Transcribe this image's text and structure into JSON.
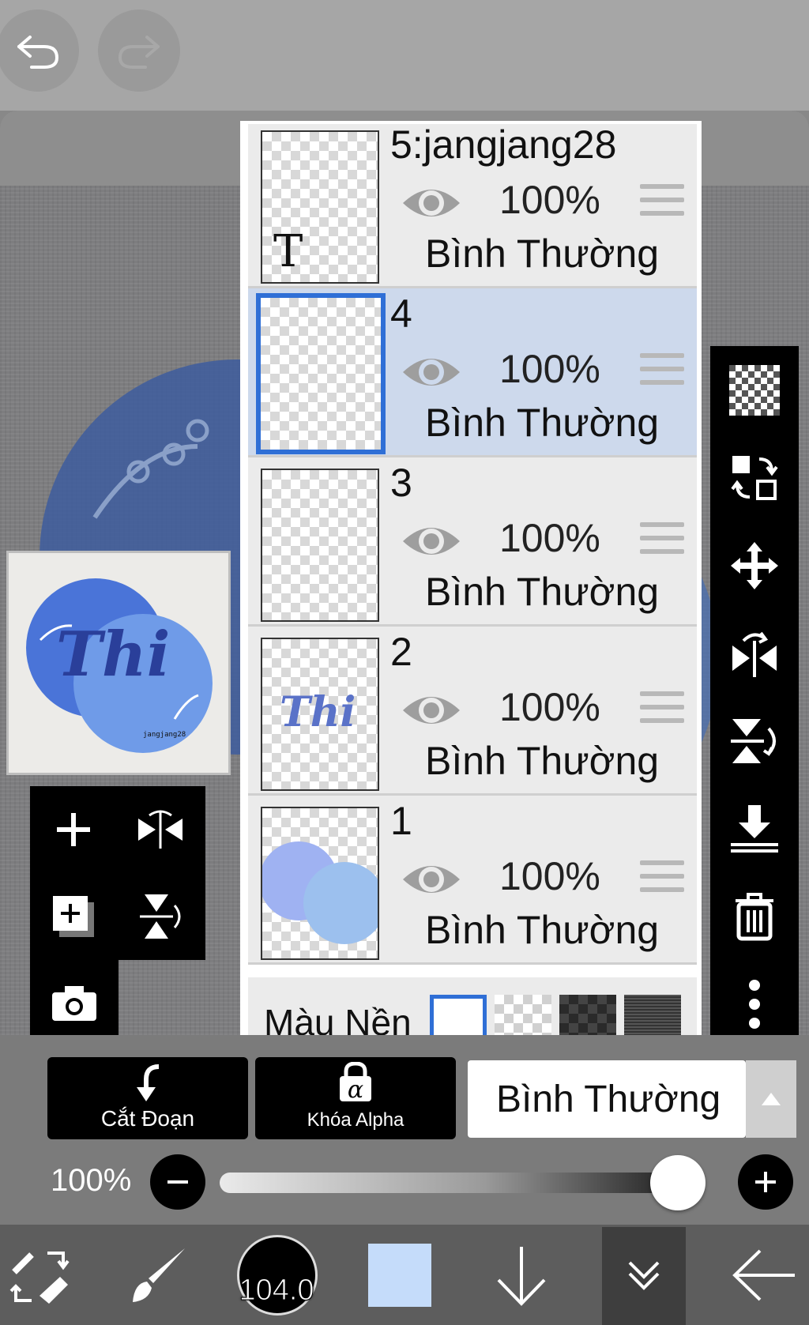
{
  "topbar": {
    "undo_icon": "undo-icon",
    "redo_icon": "redo-icon"
  },
  "layers": [
    {
      "name": "5:jangjang28",
      "opacity": "100%",
      "blend": "Bình Thường",
      "selected": false,
      "thumb": "text-T"
    },
    {
      "name": "4",
      "opacity": "100%",
      "blend": "Bình Thường",
      "selected": true,
      "thumb": "empty"
    },
    {
      "name": "3",
      "opacity": "100%",
      "blend": "Bình Thường",
      "selected": false,
      "thumb": "empty"
    },
    {
      "name": "2",
      "opacity": "100%",
      "blend": "Bình Thường",
      "selected": false,
      "thumb": "text-thi"
    },
    {
      "name": "1",
      "opacity": "100%",
      "blend": "Bình Thường",
      "selected": false,
      "thumb": "circles"
    }
  ],
  "thumb_text": {
    "layer5_T": "T",
    "layer2_thi": "Thi"
  },
  "preview": {
    "text": "Thi",
    "small_text": "jangjang28"
  },
  "background_row": {
    "label": "Màu Nền"
  },
  "controls": {
    "clip_label": "Cắt Đoạn",
    "alpha_lock_label": "Khóa Alpha",
    "alpha_symbol": "α",
    "blend_mode": "Bình Thường",
    "opacity_label": "100%",
    "opacity_value": 1.0
  },
  "bottom_nav": {
    "brush_size": "104.0",
    "color": "#c5dcfa"
  },
  "colors": {
    "selected_layer": "#cdd9ec",
    "accent": "#2f6fd6",
    "circle_blue_1": "#4a74d8",
    "circle_blue_2": "#6f9be8"
  }
}
